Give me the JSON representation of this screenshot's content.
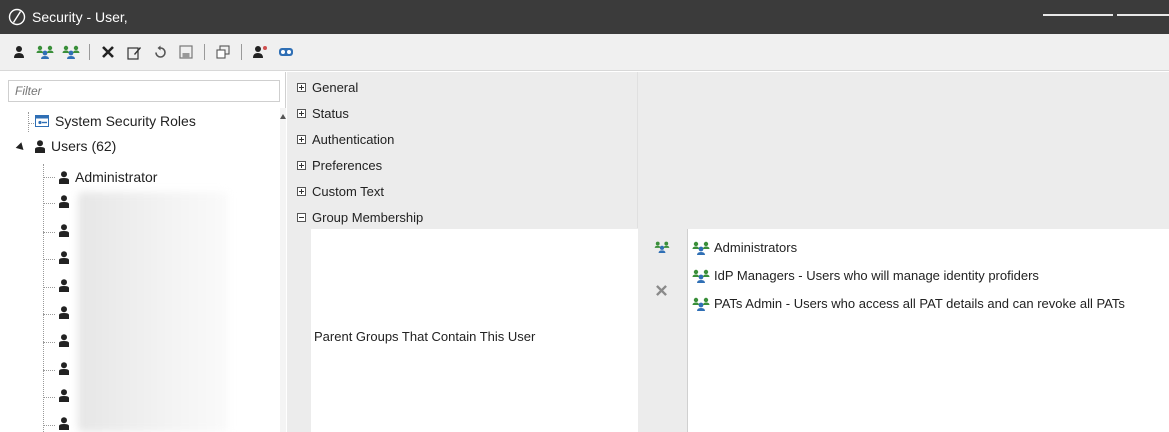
{
  "app": {
    "title": "Security - User,"
  },
  "toolbar": {
    "buttons": [
      {
        "icon": "user-icon"
      },
      {
        "icon": "group-icon"
      },
      {
        "icon": "group-add-icon"
      },
      {
        "sep": true
      },
      {
        "icon": "delete-icon"
      },
      {
        "icon": "edit-icon"
      },
      {
        "icon": "refresh-icon"
      },
      {
        "icon": "save-icon"
      },
      {
        "sep": true
      },
      {
        "icon": "window-icon"
      },
      {
        "sep": true
      },
      {
        "icon": "user-badge-icon"
      },
      {
        "icon": "role-icon"
      }
    ]
  },
  "filter": {
    "placeholder": "Filter"
  },
  "tree": {
    "roles_label": "System Security Roles",
    "users_label": "Users (62)",
    "first_user": "Administrator"
  },
  "sections": [
    {
      "label": "General",
      "expanded": false
    },
    {
      "label": "Status",
      "expanded": false
    },
    {
      "label": "Authentication",
      "expanded": false
    },
    {
      "label": "Preferences",
      "expanded": false
    },
    {
      "label": "Custom Text",
      "expanded": false
    },
    {
      "label": "Group Membership",
      "expanded": true
    }
  ],
  "group_membership": {
    "label": "Parent Groups That Contain This User",
    "groups": [
      "Administrators",
      "IdP Managers - Users who will manage identity profiders",
      "PATs Admin - Users who access all PAT details and can revoke all PATs"
    ]
  },
  "colors": {
    "titlebar": "#3b3b3b",
    "toolbar": "#f0f0f0",
    "panel": "#ececec",
    "accent_blue": "#2f6fb5",
    "accent_green": "#3a8f3a"
  }
}
